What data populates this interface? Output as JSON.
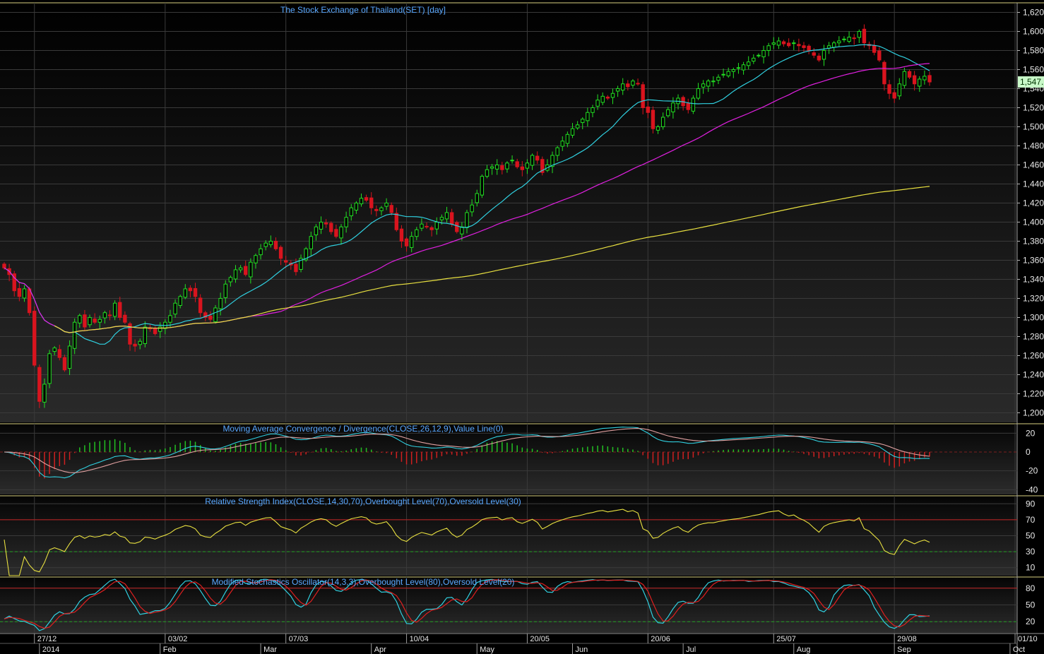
{
  "colors": {
    "background_top": "#000000",
    "background_bottom": "#2a2a2a",
    "grid": "#3a3a3a",
    "border": "#d8d080",
    "title": "#5aa8ff",
    "axis_text": "#e8e8e8",
    "candle_up": "#22e022",
    "candle_down": "#d8141e",
    "ma_short": "#30d0e0",
    "ma_mid": "#e020e0",
    "ma_long": "#e8e040",
    "macd_line": "#30d0e0",
    "macd_signal": "#e0a0a0",
    "hist_up": "#22c022",
    "hist_down": "#d02020",
    "rsi": "#e8e040",
    "stoch_k": "#30d0e0",
    "stoch_d": "#e02020",
    "overbought": "#c02020",
    "oversold": "#20a020",
    "price_tag_bg": "#c8f8c8"
  },
  "chart_data": [
    {
      "type": "candlestick",
      "title": "The Stock Exchange of Thailand(SET) [day]",
      "ylim": [
        1190,
        1630
      ],
      "y_ticks": [
        "1,200",
        "1,220",
        "1,240",
        "1,260",
        "1,280",
        "1,300",
        "1,320",
        "1,340",
        "1,360",
        "1,380",
        "1,400",
        "1,420",
        "1,440",
        "1,460",
        "1,480",
        "1,500",
        "1,520",
        "1,540",
        "1,560",
        "1,580",
        "1,600",
        "1,620"
      ],
      "last_price_label": "1,547.",
      "closes": [
        1352,
        1345,
        1328,
        1322,
        1330,
        1305,
        1250,
        1212,
        1230,
        1262,
        1268,
        1258,
        1245,
        1270,
        1295,
        1302,
        1290,
        1300,
        1295,
        1298,
        1305,
        1302,
        1315,
        1300,
        1295,
        1272,
        1270,
        1275,
        1290,
        1288,
        1283,
        1290,
        1295,
        1302,
        1315,
        1322,
        1330,
        1328,
        1322,
        1305,
        1300,
        1298,
        1310,
        1320,
        1335,
        1342,
        1350,
        1352,
        1345,
        1358,
        1365,
        1372,
        1378,
        1380,
        1372,
        1362,
        1358,
        1355,
        1348,
        1362,
        1372,
        1385,
        1395,
        1400,
        1398,
        1390,
        1385,
        1395,
        1405,
        1415,
        1420,
        1425,
        1423,
        1415,
        1412,
        1415,
        1420,
        1410,
        1392,
        1380,
        1375,
        1385,
        1392,
        1398,
        1395,
        1392,
        1400,
        1405,
        1410,
        1398,
        1390,
        1395,
        1410,
        1418,
        1430,
        1448,
        1455,
        1458,
        1460,
        1455,
        1462,
        1465,
        1458,
        1455,
        1462,
        1470,
        1465,
        1452,
        1460,
        1470,
        1478,
        1485,
        1492,
        1498,
        1502,
        1508,
        1515,
        1520,
        1528,
        1532,
        1530,
        1535,
        1540,
        1545,
        1542,
        1548,
        1545,
        1520,
        1515,
        1498,
        1500,
        1510,
        1518,
        1525,
        1530,
        1522,
        1518,
        1530,
        1540,
        1545,
        1548,
        1548,
        1552,
        1555,
        1558,
        1560,
        1562,
        1565,
        1568,
        1572,
        1575,
        1580,
        1585,
        1588,
        1590,
        1587,
        1585,
        1588,
        1585,
        1583,
        1580,
        1575,
        1570,
        1580,
        1585,
        1588,
        1590,
        1592,
        1594,
        1593,
        1600,
        1588,
        1585,
        1578,
        1570,
        1545,
        1535,
        1530,
        1545,
        1558,
        1552,
        1545,
        1550,
        1553,
        1547
      ],
      "ma_series": [
        {
          "period": 15,
          "from_index": 0
        },
        {
          "period": 50,
          "from_index": 0
        },
        {
          "period": 200,
          "from_index": 10
        }
      ],
      "x_dates": [
        {
          "label": "27/12",
          "index": 6
        },
        {
          "label": "03/02",
          "index": 32
        },
        {
          "label": "07/03",
          "index": 56
        },
        {
          "label": "10/04",
          "index": 80
        },
        {
          "label": "20/05",
          "index": 104
        },
        {
          "label": "20/06",
          "index": 128
        },
        {
          "label": "25/07",
          "index": 153
        },
        {
          "label": "29/08",
          "index": 177
        },
        {
          "label": "01/10",
          "index": 201
        }
      ],
      "x_months": [
        {
          "label": "2014",
          "index": 7
        },
        {
          "label": "Feb",
          "index": 31
        },
        {
          "label": "Mar",
          "index": 51
        },
        {
          "label": "Apr",
          "index": 73
        },
        {
          "label": "May",
          "index": 94
        },
        {
          "label": "Jun",
          "index": 113
        },
        {
          "label": "Jul",
          "index": 135
        },
        {
          "label": "Aug",
          "index": 157
        },
        {
          "label": "Sep",
          "index": 177
        },
        {
          "label": "Oct",
          "index": 200
        }
      ]
    },
    {
      "type": "macd",
      "title": "Moving Average Convergence / Divergence(CLOSE,26,12,9),Value Line(0)",
      "ylim": [
        -45,
        30
      ],
      "y_ticks": [
        "20",
        "0",
        "-20",
        "-40"
      ],
      "y_tick_values": [
        20,
        0,
        -20,
        -40
      ]
    },
    {
      "type": "rsi",
      "title": "Relative Strength Index(CLOSE,14,30,70),Overbought Level(70),Oversold Level(30)",
      "ylim": [
        0,
        100
      ],
      "y_ticks": [
        "90",
        "70",
        "50",
        "30",
        "10"
      ],
      "y_tick_values": [
        90,
        70,
        50,
        30,
        10
      ],
      "overbought": 70,
      "oversold": 30
    },
    {
      "type": "stochastic",
      "title": "Modified Stochastics Oscillator(14,3,3),Overbought Level(80),Oversold Level(20)",
      "ylim": [
        0,
        100
      ],
      "y_ticks": [
        "80",
        "50",
        "20"
      ],
      "y_tick_values": [
        80,
        50,
        20
      ],
      "overbought": 80,
      "oversold": 20
    }
  ]
}
